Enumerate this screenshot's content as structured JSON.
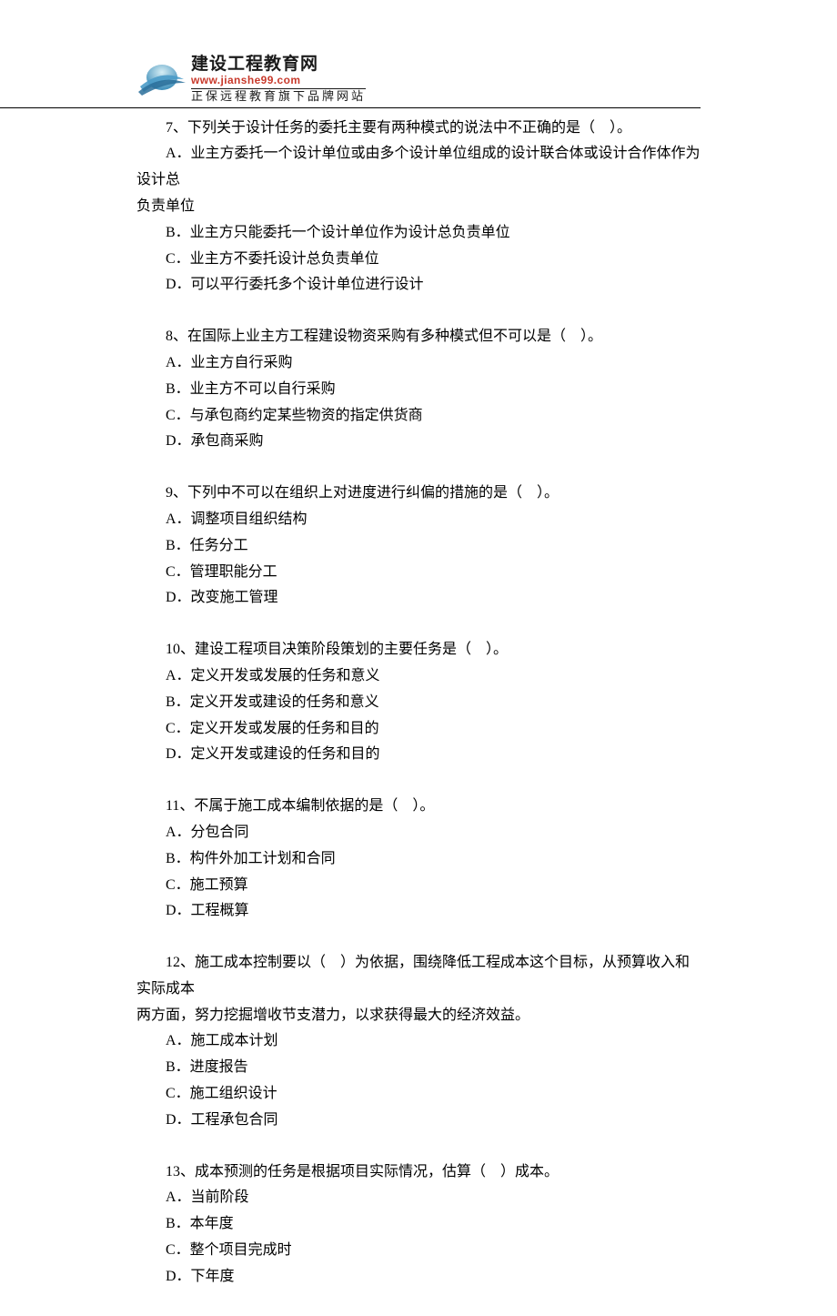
{
  "header": {
    "logo_title": "建设工程教育网",
    "logo_url": "www.jianshe99.com",
    "logo_tagline": "正保远程教育旗下品牌网站"
  },
  "questions": [
    {
      "stem_lines": [
        "7、下列关于设计任务的委托主要有两种模式的说法中不正确的是（　）。",
        "A．业主方委托一个设计单位或由多个设计单位组成的设计联合体或设计合作体作为设计总"
      ],
      "stem_continuation": "负责单位",
      "options": [
        "B．业主方只能委托一个设计单位作为设计总负责单位",
        "C．业主方不委托设计总负责单位",
        "D．可以平行委托多个设计单位进行设计"
      ]
    },
    {
      "stem_lines": [
        "8、在国际上业主方工程建设物资采购有多种模式但不可以是（　）。"
      ],
      "options": [
        "A．业主方自行采购",
        "B．业主方不可以自行采购",
        "C．与承包商约定某些物资的指定供货商",
        "D．承包商采购"
      ]
    },
    {
      "stem_lines": [
        "9、下列中不可以在组织上对进度进行纠偏的措施的是（　）。"
      ],
      "options": [
        "A．调整项目组织结构",
        "B．任务分工",
        "C．管理职能分工",
        "D．改变施工管理"
      ]
    },
    {
      "stem_lines": [
        "10、建设工程项目决策阶段策划的主要任务是（　）。"
      ],
      "options": [
        "A．定义开发或发展的任务和意义",
        "B．定义开发或建设的任务和意义",
        "C．定义开发或发展的任务和目的",
        "D．定义开发或建设的任务和目的"
      ]
    },
    {
      "stem_lines": [
        "11、不属于施工成本编制依据的是（　）。"
      ],
      "options": [
        "A．分包合同",
        "B．构件外加工计划和合同",
        "C．施工预算",
        "D．工程概算"
      ]
    },
    {
      "stem_lines": [
        "12、施工成本控制要以（　）为依据，围绕降低工程成本这个目标，从预算收入和实际成本"
      ],
      "stem_continuation": "两方面，努力挖掘增收节支潜力，以求获得最大的经济效益。",
      "options": [
        "A．施工成本计划",
        "B．进度报告",
        "C．施工组织设计",
        "D．工程承包合同"
      ]
    },
    {
      "stem_lines": [
        "13、成本预测的任务是根据项目实际情况，估算（　）成本。"
      ],
      "options": [
        "A．当前阶段",
        "B．本年度",
        "C．整个项目完成时",
        "D．下年度"
      ]
    }
  ]
}
